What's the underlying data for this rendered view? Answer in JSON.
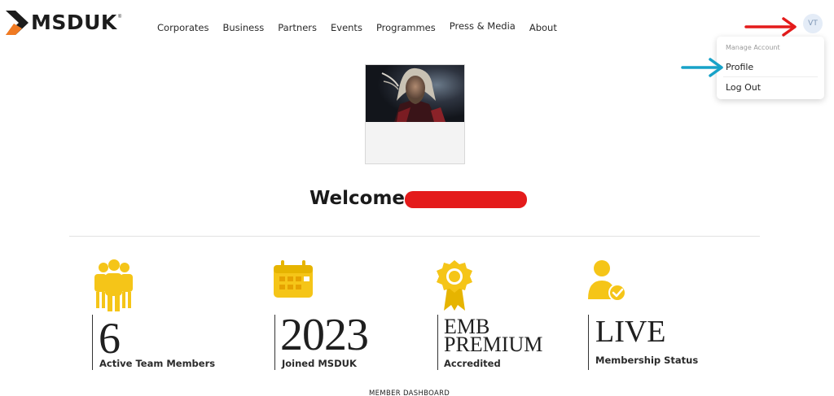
{
  "brand": {
    "name": "MSDUK",
    "reg_mark": "®"
  },
  "nav": {
    "items": [
      {
        "label": "Corporates"
      },
      {
        "label": "Business"
      },
      {
        "label": "Partners"
      },
      {
        "label": "Events"
      },
      {
        "label": "Programmes"
      },
      {
        "label": "Press & Media"
      },
      {
        "label": "About"
      }
    ]
  },
  "account": {
    "avatar_initials": "VT",
    "menu": {
      "heading": "Manage Account",
      "profile_label": "Profile",
      "logout_label": "Log Out"
    }
  },
  "welcome": {
    "text": "Welcome"
  },
  "stats": [
    {
      "value": "6",
      "label": "Active Team Members",
      "icon": "team-icon"
    },
    {
      "value": "2023",
      "label": "Joined MSDUK",
      "icon": "calendar-icon"
    },
    {
      "value_line1": "EMB",
      "value_line2": "PREMIUM",
      "label": "Accredited",
      "icon": "award-badge-icon"
    },
    {
      "value": "LIVE",
      "label": "Membership Status",
      "icon": "verified-user-icon"
    }
  ],
  "footer": {
    "section_label": "MEMBER DASHBOARD"
  },
  "colors": {
    "accent_orange": "#f07a22",
    "icon_gold": "#f5c518",
    "annotation_red": "#e41b1b",
    "annotation_blue": "#17a2c8",
    "avatar_bg": "#e4ecf7"
  }
}
